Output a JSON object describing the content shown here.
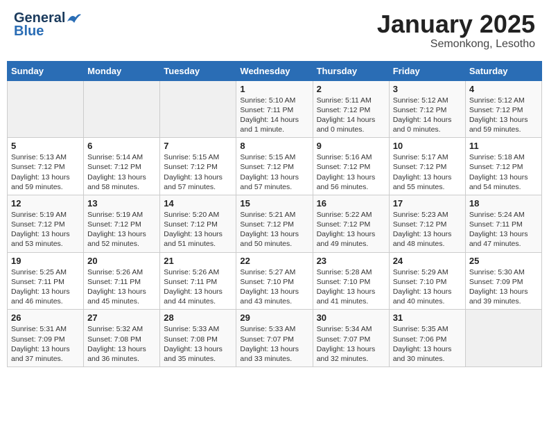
{
  "header": {
    "logo_general": "General",
    "logo_blue": "Blue",
    "month_title": "January 2025",
    "location": "Semonkong, Lesotho"
  },
  "weekdays": [
    "Sunday",
    "Monday",
    "Tuesday",
    "Wednesday",
    "Thursday",
    "Friday",
    "Saturday"
  ],
  "weeks": [
    {
      "days": [
        {
          "date": "",
          "empty": true
        },
        {
          "date": "",
          "empty": true
        },
        {
          "date": "",
          "empty": true
        },
        {
          "date": "1",
          "sunrise": "5:10 AM",
          "sunset": "7:11 PM",
          "daylight": "14 hours and 1 minute."
        },
        {
          "date": "2",
          "sunrise": "5:11 AM",
          "sunset": "7:12 PM",
          "daylight": "14 hours and 0 minutes."
        },
        {
          "date": "3",
          "sunrise": "5:12 AM",
          "sunset": "7:12 PM",
          "daylight": "14 hours and 0 minutes."
        },
        {
          "date": "4",
          "sunrise": "5:12 AM",
          "sunset": "7:12 PM",
          "daylight": "13 hours and 59 minutes."
        }
      ]
    },
    {
      "days": [
        {
          "date": "5",
          "sunrise": "5:13 AM",
          "sunset": "7:12 PM",
          "daylight": "13 hours and 59 minutes."
        },
        {
          "date": "6",
          "sunrise": "5:14 AM",
          "sunset": "7:12 PM",
          "daylight": "13 hours and 58 minutes."
        },
        {
          "date": "7",
          "sunrise": "5:15 AM",
          "sunset": "7:12 PM",
          "daylight": "13 hours and 57 minutes."
        },
        {
          "date": "8",
          "sunrise": "5:15 AM",
          "sunset": "7:12 PM",
          "daylight": "13 hours and 57 minutes."
        },
        {
          "date": "9",
          "sunrise": "5:16 AM",
          "sunset": "7:12 PM",
          "daylight": "13 hours and 56 minutes."
        },
        {
          "date": "10",
          "sunrise": "5:17 AM",
          "sunset": "7:12 PM",
          "daylight": "13 hours and 55 minutes."
        },
        {
          "date": "11",
          "sunrise": "5:18 AM",
          "sunset": "7:12 PM",
          "daylight": "13 hours and 54 minutes."
        }
      ]
    },
    {
      "days": [
        {
          "date": "12",
          "sunrise": "5:19 AM",
          "sunset": "7:12 PM",
          "daylight": "13 hours and 53 minutes."
        },
        {
          "date": "13",
          "sunrise": "5:19 AM",
          "sunset": "7:12 PM",
          "daylight": "13 hours and 52 minutes."
        },
        {
          "date": "14",
          "sunrise": "5:20 AM",
          "sunset": "7:12 PM",
          "daylight": "13 hours and 51 minutes."
        },
        {
          "date": "15",
          "sunrise": "5:21 AM",
          "sunset": "7:12 PM",
          "daylight": "13 hours and 50 minutes."
        },
        {
          "date": "16",
          "sunrise": "5:22 AM",
          "sunset": "7:12 PM",
          "daylight": "13 hours and 49 minutes."
        },
        {
          "date": "17",
          "sunrise": "5:23 AM",
          "sunset": "7:12 PM",
          "daylight": "13 hours and 48 minutes."
        },
        {
          "date": "18",
          "sunrise": "5:24 AM",
          "sunset": "7:11 PM",
          "daylight": "13 hours and 47 minutes."
        }
      ]
    },
    {
      "days": [
        {
          "date": "19",
          "sunrise": "5:25 AM",
          "sunset": "7:11 PM",
          "daylight": "13 hours and 46 minutes."
        },
        {
          "date": "20",
          "sunrise": "5:26 AM",
          "sunset": "7:11 PM",
          "daylight": "13 hours and 45 minutes."
        },
        {
          "date": "21",
          "sunrise": "5:26 AM",
          "sunset": "7:11 PM",
          "daylight": "13 hours and 44 minutes."
        },
        {
          "date": "22",
          "sunrise": "5:27 AM",
          "sunset": "7:10 PM",
          "daylight": "13 hours and 43 minutes."
        },
        {
          "date": "23",
          "sunrise": "5:28 AM",
          "sunset": "7:10 PM",
          "daylight": "13 hours and 41 minutes."
        },
        {
          "date": "24",
          "sunrise": "5:29 AM",
          "sunset": "7:10 PM",
          "daylight": "13 hours and 40 minutes."
        },
        {
          "date": "25",
          "sunrise": "5:30 AM",
          "sunset": "7:09 PM",
          "daylight": "13 hours and 39 minutes."
        }
      ]
    },
    {
      "days": [
        {
          "date": "26",
          "sunrise": "5:31 AM",
          "sunset": "7:09 PM",
          "daylight": "13 hours and 37 minutes."
        },
        {
          "date": "27",
          "sunrise": "5:32 AM",
          "sunset": "7:08 PM",
          "daylight": "13 hours and 36 minutes."
        },
        {
          "date": "28",
          "sunrise": "5:33 AM",
          "sunset": "7:08 PM",
          "daylight": "13 hours and 35 minutes."
        },
        {
          "date": "29",
          "sunrise": "5:33 AM",
          "sunset": "7:07 PM",
          "daylight": "13 hours and 33 minutes."
        },
        {
          "date": "30",
          "sunrise": "5:34 AM",
          "sunset": "7:07 PM",
          "daylight": "13 hours and 32 minutes."
        },
        {
          "date": "31",
          "sunrise": "5:35 AM",
          "sunset": "7:06 PM",
          "daylight": "13 hours and 30 minutes."
        },
        {
          "date": "",
          "empty": true
        }
      ]
    }
  ],
  "labels": {
    "sunrise": "Sunrise:",
    "sunset": "Sunset:",
    "daylight": "Daylight:"
  }
}
